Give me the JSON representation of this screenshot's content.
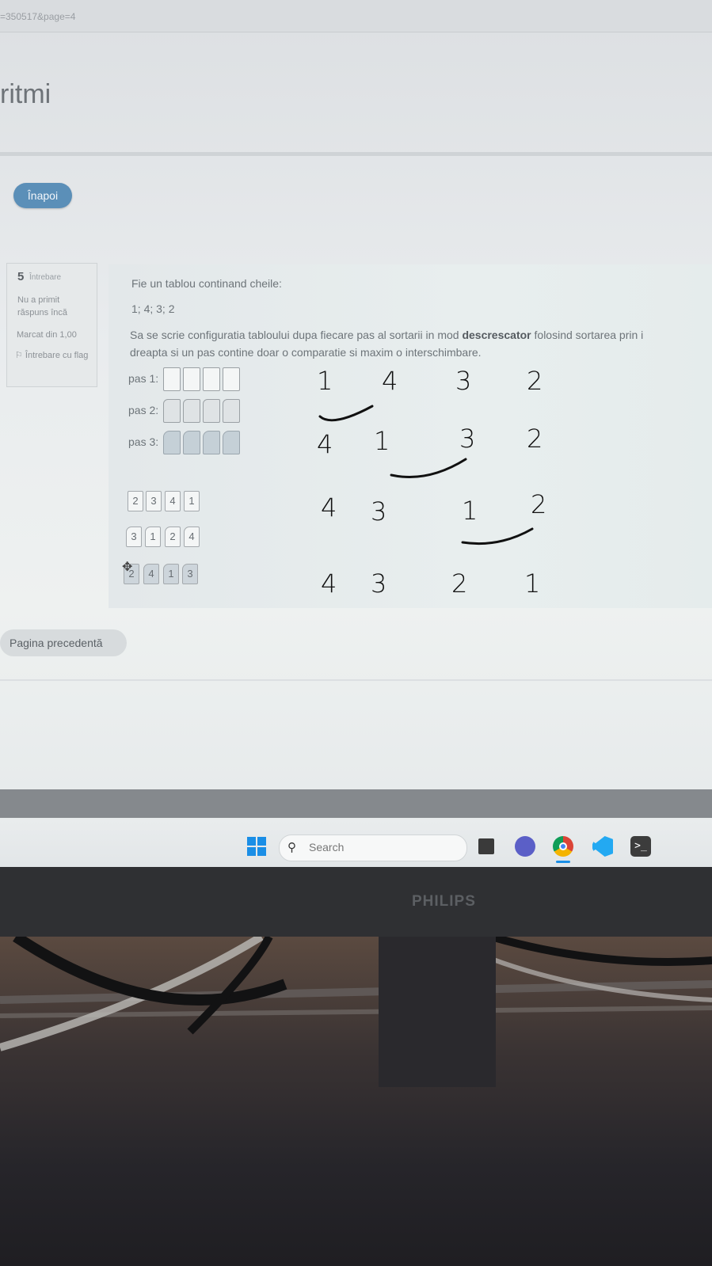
{
  "browser": {
    "url_fragment": "=350517&page=4"
  },
  "page": {
    "heading_fragment": "ritmi",
    "back_button": "Înapoi"
  },
  "question_info": {
    "number": "5",
    "number_label": "Întrebare",
    "status": "Nu a primit răspuns încă",
    "marks": "Marcat din 1,00",
    "flag": "Întrebare cu flag"
  },
  "question": {
    "intro": "Fie un tablou continand cheile:",
    "keys": "1; 4; 3; 2",
    "instruction_part1": "Sa se scrie configuratia tabloului dupa fiecare pas al sortarii in mod ",
    "instruction_bold": "descrescator",
    "instruction_part2": " folosind sortarea prin i",
    "instruction_line2": "dreapta si un pas contine doar o comparatie si maxim o interschimbare.",
    "steps": [
      "pas 1:",
      "pas 2:",
      "pas 3:"
    ],
    "answer_options": [
      [
        "2",
        "3",
        "4",
        "1"
      ],
      [
        "3",
        "1",
        "2",
        "4"
      ],
      [
        "2",
        "4",
        "1",
        "3"
      ]
    ]
  },
  "handwriting": {
    "rows": [
      [
        "1",
        "4",
        "3",
        "2"
      ],
      [
        "4",
        "1",
        "3",
        "2"
      ],
      [
        "4",
        "3",
        "1",
        "2"
      ],
      [
        "4",
        "3",
        "2",
        "1"
      ]
    ]
  },
  "navigation": {
    "previous_page": "Pagina precedentă"
  },
  "taskbar": {
    "search_placeholder": "Search",
    "icons": [
      "windows-start-icon",
      "search-icon",
      "task-view-icon",
      "teams-icon",
      "chrome-icon",
      "vscode-icon",
      "terminal-icon"
    ]
  },
  "monitor": {
    "brand": "PHILIPS"
  }
}
